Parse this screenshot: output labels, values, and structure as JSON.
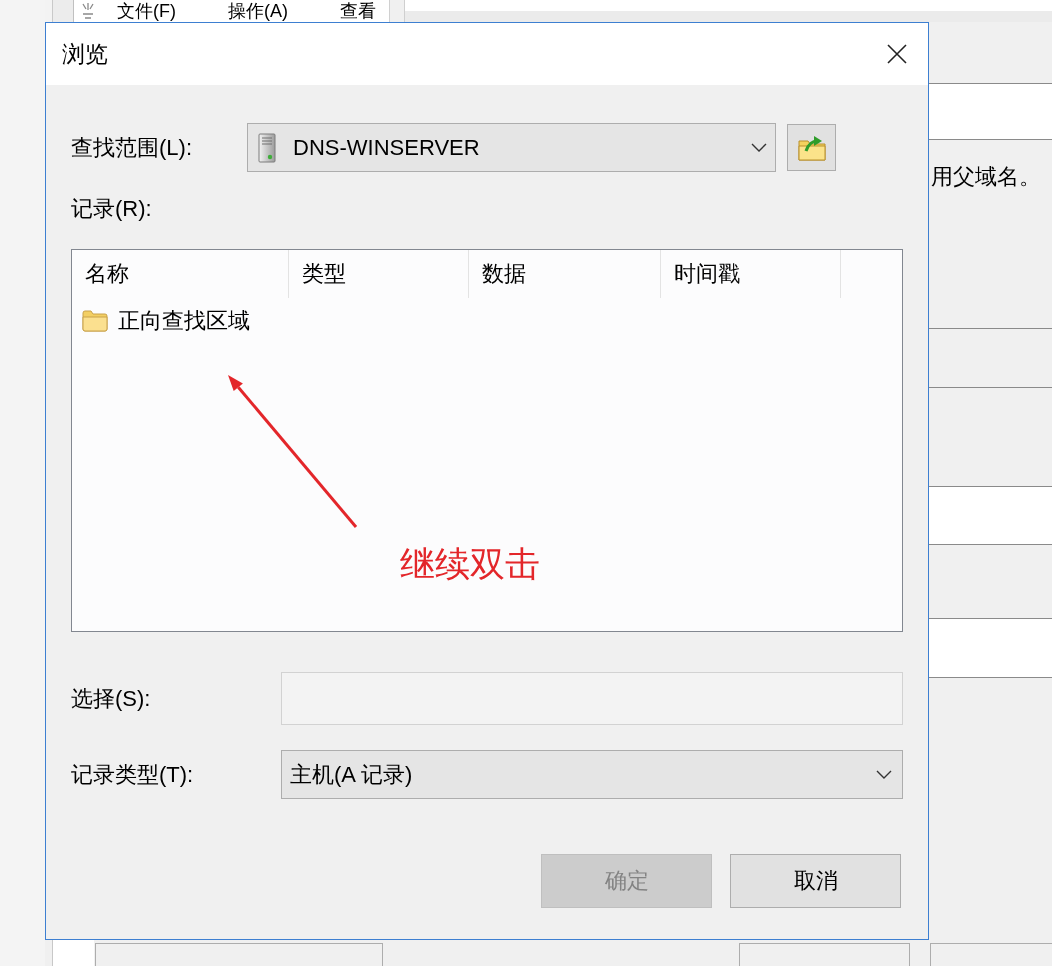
{
  "background_window": {
    "menu": [
      "文件(F)",
      "操作(A)",
      "查看"
    ],
    "side_text": "用父域名。"
  },
  "dialog": {
    "title": "浏览",
    "look_in": {
      "label": "查找范围(L):",
      "value": "DNS-WINSERVER"
    },
    "records": {
      "label": "记录(R):",
      "columns": [
        "名称",
        "类型",
        "数据",
        "时间戳"
      ],
      "rows": [
        {
          "name": "正向查找区域",
          "selected": false
        }
      ]
    },
    "selection": {
      "label": "选择(S):"
    },
    "record_type": {
      "label": "记录类型(T):",
      "value": "主机(A 记录)"
    },
    "buttons": [
      {
        "label": "确定",
        "disabled": true
      },
      {
        "label": "取消",
        "disabled": false
      }
    ]
  },
  "annotation": {
    "text": "继续双击"
  }
}
